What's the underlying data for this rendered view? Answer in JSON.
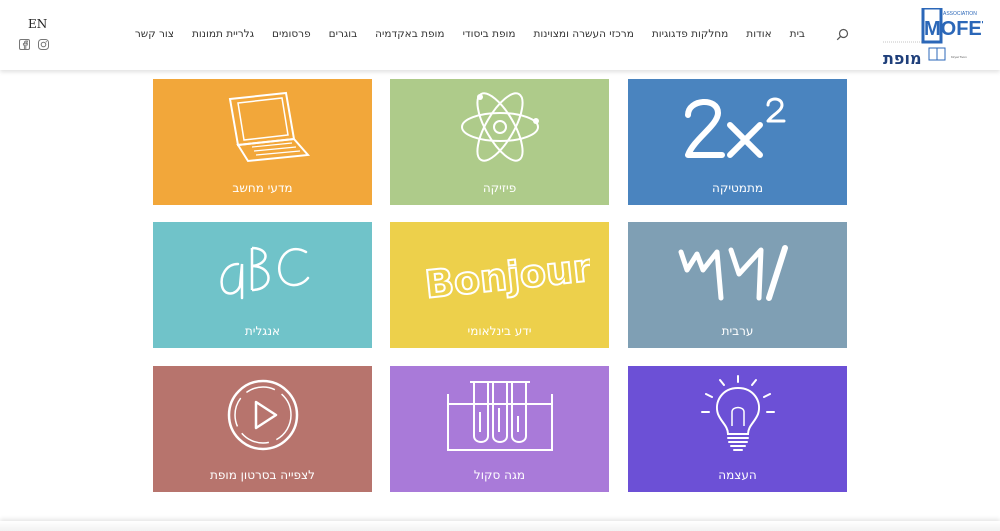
{
  "header": {
    "language_switch": "EN",
    "social": {
      "facebook_icon": "facebook-icon",
      "instagram_icon": "instagram-icon"
    },
    "nav": [
      "בית",
      "אודות",
      "מחלקות פדגוגיות",
      "מרכזי העשרה ומצוינות",
      "מופת ביסודי",
      "מופת באקדמיה",
      "בוגרים",
      "פרסומים",
      "גלריית תמונות",
      "צור קשר"
    ],
    "logo": {
      "association": "ASSOCIATION",
      "wordmark": "MOFET",
      "hebrew": "מופת"
    }
  },
  "tiles": [
    {
      "label": "מתמטיקה",
      "color": "#4a84bf",
      "icon": "math-2x2-icon"
    },
    {
      "label": "פיזיקה",
      "color": "#aecb8a",
      "icon": "atom-icon"
    },
    {
      "label": "מדעי מחשב",
      "color": "#f2a73a",
      "icon": "laptop-icon"
    },
    {
      "label": "ערבית",
      "color": "#7f9fb4",
      "icon": "arabic-numerals-icon"
    },
    {
      "label": "ידע בינלאומי",
      "color": "#edd04b",
      "icon": "bonjour-icon"
    },
    {
      "label": "אנגלית",
      "color": "#70c3c9",
      "icon": "abc-icon"
    },
    {
      "label": "העצמה",
      "color": "#6c50d6",
      "icon": "lightbulb-icon"
    },
    {
      "label": "מגה סקול",
      "color": "#a97ad9",
      "icon": "test-tubes-icon"
    },
    {
      "label": "לצפייה בסרטון מופת",
      "color": "#b7746d",
      "icon": "play-video-icon"
    }
  ]
}
